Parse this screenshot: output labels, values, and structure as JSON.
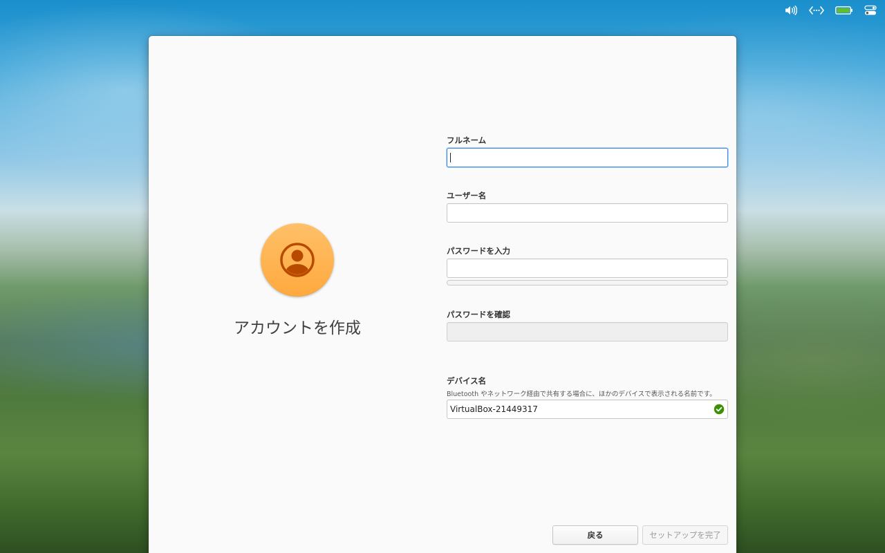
{
  "panel": {
    "icons": [
      "volume-icon",
      "network-icon",
      "battery-icon",
      "control-center-icon"
    ],
    "battery_color": "#5fbf2e"
  },
  "dialog": {
    "title": "アカウントを作成",
    "avatar_icon": "user-icon",
    "avatar_color": "#ffa93e"
  },
  "form": {
    "full_name": {
      "label": "フルネーム",
      "value": ""
    },
    "username": {
      "label": "ユーザー名",
      "value": ""
    },
    "password": {
      "label": "パスワードを入力",
      "value": ""
    },
    "password_confirm": {
      "label": "パスワードを確認",
      "value": ""
    },
    "device_name": {
      "label": "デバイス名",
      "hint": "Bluetooth やネットワーク経由で共有する場合に、ほかのデバイスで表示される名前です。",
      "value": "VirtualBox-21449317",
      "status_icon": "check-icon",
      "status_color": "#3a9104"
    }
  },
  "buttons": {
    "back": "戻る",
    "finish": "セットアップを完了"
  }
}
